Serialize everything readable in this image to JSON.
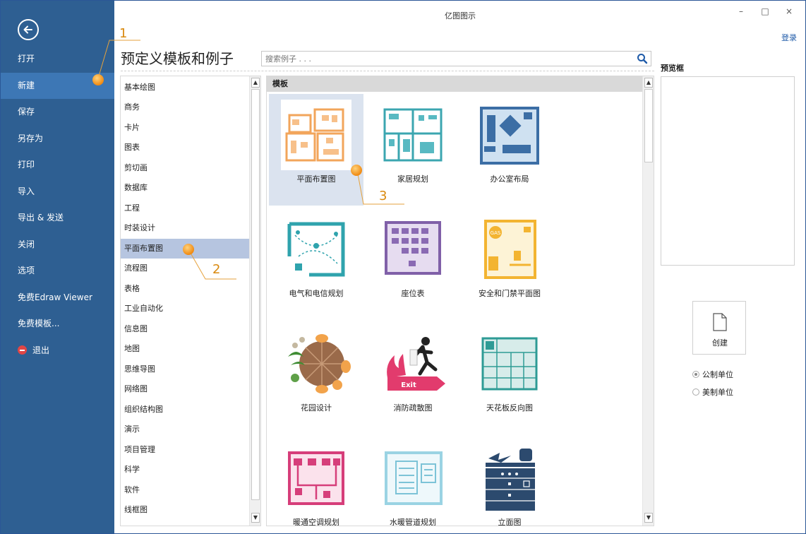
{
  "window": {
    "title": "亿图图示",
    "minimize": "–",
    "maximize": "□",
    "close": "×",
    "login": "登录"
  },
  "sidebar": {
    "items": [
      {
        "label": "打开"
      },
      {
        "label": "新建"
      },
      {
        "label": "保存"
      },
      {
        "label": "另存为"
      },
      {
        "label": "打印"
      },
      {
        "label": "导入"
      },
      {
        "label": "导出 & 发送"
      },
      {
        "label": "关闭"
      },
      {
        "label": "选项"
      },
      {
        "label": "免费Edraw Viewer"
      },
      {
        "label": "免费模板..."
      },
      {
        "label": "退出"
      }
    ],
    "active_index": 1,
    "colors": {
      "bg": "#2e5f92",
      "active": "#3d77b5"
    }
  },
  "header": {
    "title": "预定义模板和例子"
  },
  "search": {
    "placeholder": "搜索例子 . . ."
  },
  "categories": {
    "items": [
      "基本绘图",
      "商务",
      "卡片",
      "图表",
      "剪切画",
      "数据库",
      "工程",
      "时装设计",
      "平面布置图",
      "流程图",
      "表格",
      "工业自动化",
      "信息图",
      "地图",
      "思维导图",
      "网络图",
      "组织结构图",
      "演示",
      "项目管理",
      "科学",
      "软件",
      "线框图"
    ],
    "active_index": 8
  },
  "templates": {
    "header": "模板",
    "items": [
      {
        "label": "平面布置图",
        "icon": "floor-plan-icon"
      },
      {
        "label": "家居规划",
        "icon": "home-plan-icon"
      },
      {
        "label": "办公室布局",
        "icon": "office-layout-icon"
      },
      {
        "label": "电气和电信规划",
        "icon": "electrical-plan-icon"
      },
      {
        "label": "座位表",
        "icon": "seating-chart-icon"
      },
      {
        "label": "安全和门禁平面图",
        "icon": "security-plan-icon"
      },
      {
        "label": "花园设计",
        "icon": "garden-design-icon"
      },
      {
        "label": "消防疏散图",
        "icon": "fire-exit-icon"
      },
      {
        "label": "天花板反向图",
        "icon": "ceiling-plan-icon"
      },
      {
        "label": "暖通空调规划",
        "icon": "hvac-plan-icon"
      },
      {
        "label": "水暖管道规划",
        "icon": "plumbing-plan-icon"
      },
      {
        "label": "立面图",
        "icon": "elevation-icon"
      }
    ],
    "selected_index": 0,
    "exit_sign_text": "Exit",
    "gas_text": "GAS"
  },
  "preview": {
    "title": "预览框"
  },
  "create": {
    "label": "创建"
  },
  "units": {
    "metric": "公制单位",
    "us": "美制单位",
    "selected": "metric"
  },
  "callouts": [
    "1",
    "2",
    "3"
  ],
  "accent": "#f08a12"
}
